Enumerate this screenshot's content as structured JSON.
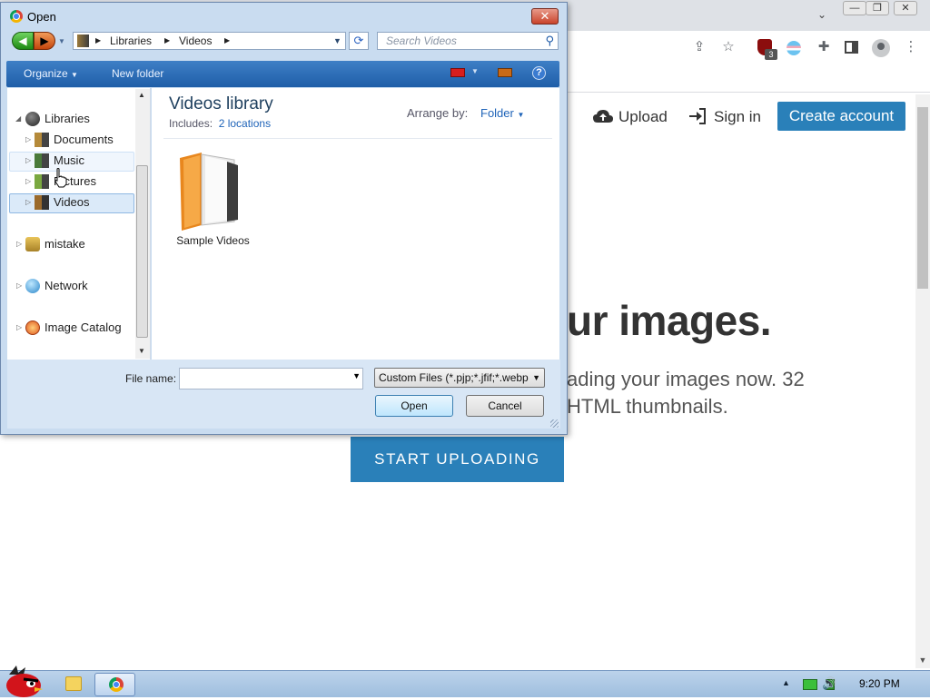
{
  "browser": {
    "window_controls": {
      "minimize": "—",
      "restore": "❐",
      "close": "✕"
    },
    "extension_badge": "3"
  },
  "site": {
    "upload_label": "Upload",
    "signin_label": "Sign in",
    "create_account_label": "Create account",
    "hero_title": "ur images.",
    "hero_line1": "ading your images now. 32",
    "hero_line2": "HTML thumbnails.",
    "start_button": "START UPLOADING"
  },
  "dialog": {
    "title": "Open",
    "breadcrumb": [
      "Libraries",
      "Videos"
    ],
    "search_placeholder": "Search Videos",
    "commands": {
      "organize": "Organize",
      "new_folder": "New folder"
    },
    "nav": [
      {
        "label": "Libraries",
        "expanded": true
      },
      {
        "label": "Documents"
      },
      {
        "label": "Music"
      },
      {
        "label": "Pictures"
      },
      {
        "label": "Videos",
        "selected": true
      },
      {
        "label": "mistake"
      },
      {
        "label": "Network"
      },
      {
        "label": "Image Catalog"
      }
    ],
    "library_title": "Videos library",
    "includes_label": "Includes:",
    "includes_value": "2 locations",
    "arrange_label": "Arrange by:",
    "arrange_value": "Folder",
    "items": [
      {
        "label": "Sample Videos"
      }
    ],
    "file_name_label": "File name:",
    "file_name_value": "",
    "filter_value": "Custom Files (*.pjp;*.jfif;*.webp",
    "open_button": "Open",
    "cancel_button": "Cancel"
  },
  "taskbar": {
    "clock": "9:20 PM"
  },
  "colors": {
    "brand_blue": "#2a80b9",
    "dialog_frame": "#c9dcf0",
    "command_bar": "#1f5ea8"
  }
}
